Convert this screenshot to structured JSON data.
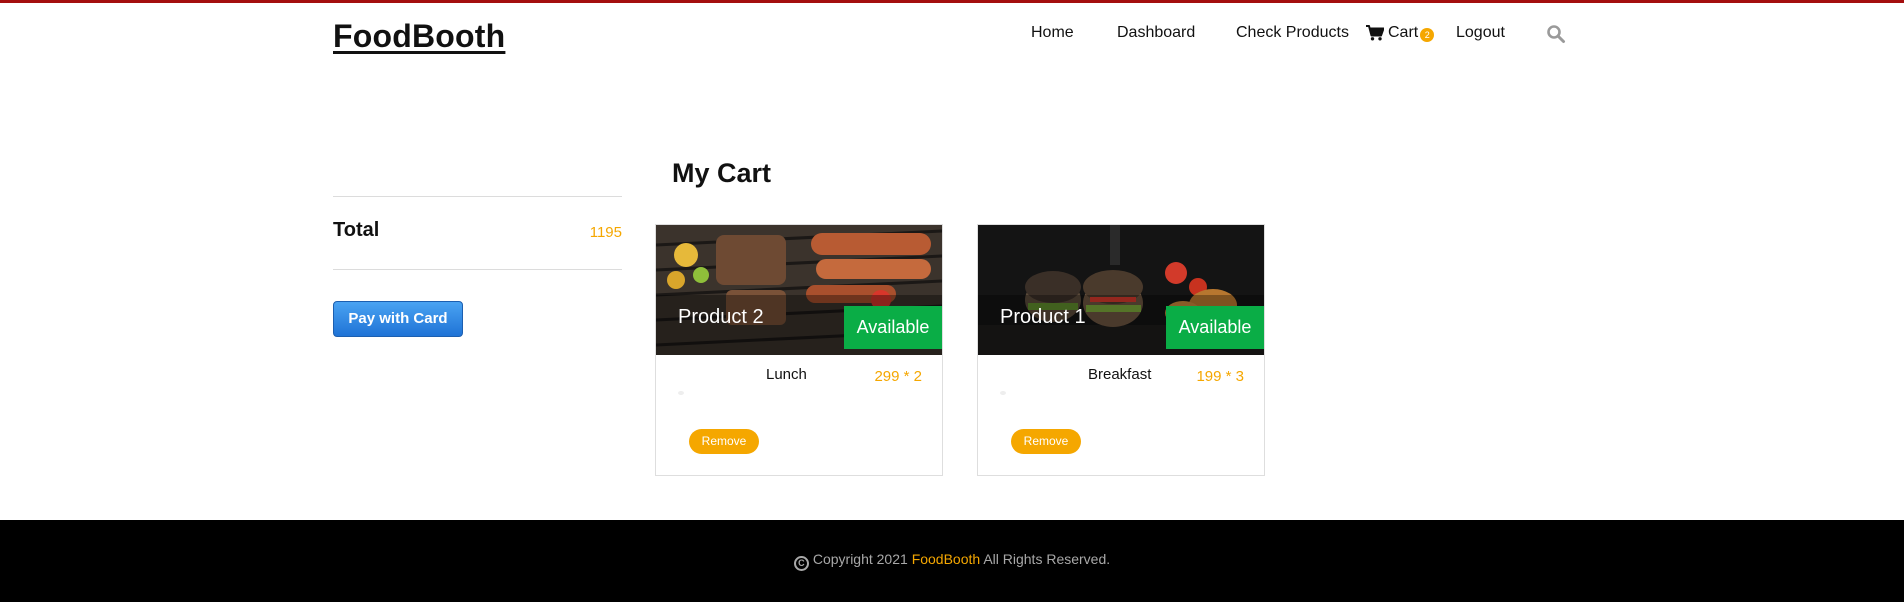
{
  "header": {
    "logo": "FoodBooth",
    "nav": {
      "home": "Home",
      "dashboard": "Dashboard",
      "check_products": "Check Products",
      "cart": "Cart",
      "cart_count": "2",
      "logout": "Logout"
    },
    "search_icon": "search-icon",
    "cart_icon": "shopping-cart-icon"
  },
  "main": {
    "title": "My Cart"
  },
  "summary": {
    "total_label": "Total",
    "total_value": "1195",
    "pay_label": "Pay with Card"
  },
  "cart_items": [
    {
      "name": "Product 2",
      "status": "Available",
      "category": "Lunch",
      "price": "299 * 2",
      "remove_label": "Remove",
      "image": "grilled-food-image"
    },
    {
      "name": "Product 1",
      "status": "Available",
      "category": "Breakfast",
      "price": "199 * 3",
      "remove_label": "Remove",
      "image": "burgers-image"
    }
  ],
  "footer": {
    "copyright_prefix": "Copyright 2021",
    "brand": "FoodBooth",
    "copyright_suffix": "All Rights Reserved."
  },
  "colors": {
    "accent": "#f5a700",
    "topbar": "#a40e0e",
    "available": "#0aad46",
    "pay_button": "#1f73d6",
    "footer_bg": "#000000"
  }
}
